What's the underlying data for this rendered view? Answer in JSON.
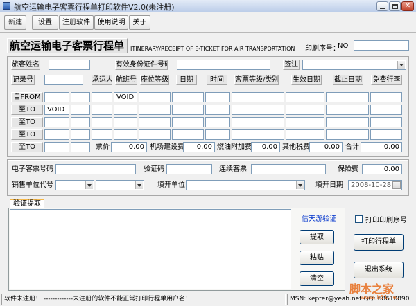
{
  "window": {
    "title": "航空运输电子客票行程单打印软件V2.0(未注册)"
  },
  "toolbar": {
    "new": "新建",
    "settings": "设置",
    "register": "注册软件",
    "help": "使用说明",
    "about": "关于"
  },
  "header": {
    "title": "航空运输电子客票行程单",
    "subtitle": "ITINERARY/RECEIPT OF E-TICKET FOR AIR TRANSPORTATION",
    "serial_label": "印刷序号：",
    "serial_prefix": "NO",
    "serial_value": ""
  },
  "passenger": {
    "name_label": "旅客姓名",
    "name": "",
    "id_label": "有效身份证件号码",
    "id": "",
    "endorse_label": "签注",
    "endorse": ""
  },
  "itinerary": {
    "headers": {
      "record_no": "记录号",
      "carrier": "承运人",
      "flight": "航班号",
      "seat_class": "座位等级",
      "date": "日期",
      "time": "时间",
      "fare_basis": "客票等级/类别",
      "valid_from": "生效日期",
      "valid_to": "截止日期",
      "baggage": "免费行李"
    },
    "record_no": "",
    "rows": [
      {
        "label": "自FROM",
        "cells": [
          "",
          "",
          "",
          "VOID",
          "",
          "",
          "",
          "",
          "",
          "",
          ""
        ]
      },
      {
        "label": "至TO",
        "cells": [
          "VOID",
          "",
          "",
          "",
          "",
          "",
          "",
          "",
          "",
          "",
          ""
        ]
      },
      {
        "label": "至TO",
        "cells": [
          "",
          "",
          "",
          "",
          "",
          "",
          "",
          "",
          "",
          "",
          ""
        ]
      },
      {
        "label": "至TO",
        "cells": [
          "",
          "",
          "",
          "",
          "",
          "",
          "",
          "",
          "",
          "",
          ""
        ]
      }
    ],
    "last_row": {
      "label": "至TO",
      "cells": [
        "",
        ""
      ]
    }
  },
  "fees": {
    "fare_label": "票价",
    "fare": "0.00",
    "airport_tax_label": "机场建设费",
    "airport_tax": "0.00",
    "fuel_label": "燃油附加费",
    "fuel": "0.00",
    "other_label": "其他税费",
    "other": "0.00",
    "total_label": "合计",
    "total": "0.00"
  },
  "ticket": {
    "eticket_label": "电子客票号码",
    "eticket": "",
    "verify_label": "验证码",
    "verify": "",
    "conj_label": "连续客票",
    "conj": "",
    "insurance_label": "保险费",
    "insurance": "0.00",
    "agent_label": "销售单位代号",
    "agent": "",
    "agent_name": "",
    "issuer_label": "填开单位",
    "issuer": "",
    "date_label": "填开日期",
    "date": "2008-10-28"
  },
  "extract": {
    "tab": "验证提取",
    "text": "",
    "link": "信天游验证",
    "fetch": "提取",
    "paste": "粘贴",
    "clear": "清空"
  },
  "actions": {
    "print_serial": "打印印刷序号",
    "print_serial_checked": false,
    "print": "打印行程单",
    "exit": "退出系统"
  },
  "status": {
    "message": "软件未注册！ -------------未注册的软件不能正常打印行程单用户名！",
    "contact": "MSN: kepter@yeah.net   QQ: 68610890"
  },
  "watermark": {
    "brand": "脚本之家",
    "url": "www.jb51.net"
  },
  "colors": {
    "accent": "#f5b84a",
    "link": "#0033cc",
    "title_bar": "#bccde9"
  }
}
